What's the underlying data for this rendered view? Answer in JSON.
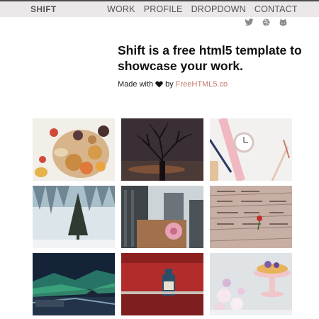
{
  "header": {
    "logo": "SHIFT",
    "nav": [
      {
        "label": "WORK"
      },
      {
        "label": "PROFILE"
      },
      {
        "label": "DROPDOWN"
      },
      {
        "label": "CONTACT"
      }
    ]
  },
  "social": [
    {
      "icon": "twitter-icon"
    },
    {
      "icon": "dribbble-icon"
    },
    {
      "icon": "github-icon"
    }
  ],
  "hero": {
    "title": "Shift is a free html5 template to showcase your work.",
    "made_with": "Made with",
    "by": "by",
    "credit": "FreeHTML5.co"
  },
  "colors": {
    "topbar_bg": "#ece7e8",
    "nav_text": "#555555",
    "credit": "#c17a6c"
  }
}
